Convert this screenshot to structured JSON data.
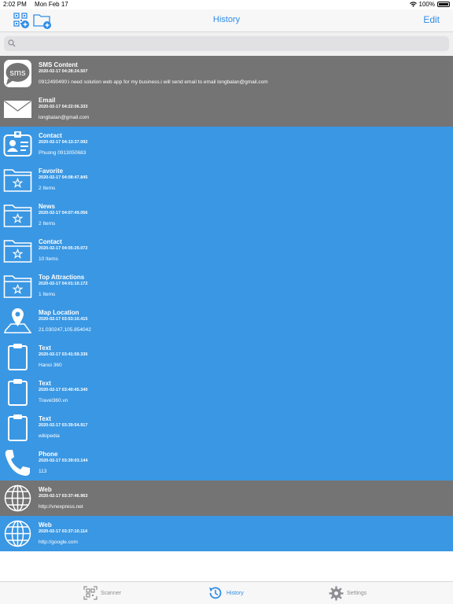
{
  "status_bar": {
    "time": "2:02 PM",
    "date": "Mon Feb 17",
    "battery": "100%"
  },
  "nav": {
    "title": "History",
    "edit_label": "Edit"
  },
  "search": {
    "placeholder": ""
  },
  "items": [
    {
      "kind": "sms",
      "style": "gray",
      "title": "SMS Content",
      "date": "2020-02-17 04:28:24.507",
      "content": "0912490490:i need solution web app for my business.i will send email to email longbalan@gmail.com"
    },
    {
      "kind": "email",
      "style": "gray",
      "title": "Email",
      "date": "2020-02-17 04:22:06.333",
      "content": "longbalan@gmail.com"
    },
    {
      "kind": "contact",
      "style": "blue",
      "title": "Contact",
      "date": "2020-02-17 04:13:37.092",
      "content": " Phuong 0913050683"
    },
    {
      "kind": "folder",
      "style": "blue",
      "title": "Favorite",
      "date": "2020-02-17 04:08:47.845",
      "content": "2 Items"
    },
    {
      "kind": "folder",
      "style": "blue",
      "title": "News",
      "date": "2020-02-17 04:07:49.056",
      "content": "2 Items"
    },
    {
      "kind": "folder",
      "style": "blue",
      "title": "Contact",
      "date": "2020-02-17 04:05:29.072",
      "content": "10 Items"
    },
    {
      "kind": "folder",
      "style": "blue",
      "title": "Top Attractions",
      "date": "2020-02-17 04:01:10.172",
      "content": "1 Items"
    },
    {
      "kind": "map",
      "style": "blue",
      "title": "Map Location",
      "date": "2020-02-17 03:53:10.415",
      "content": "21.030247,105.854042"
    },
    {
      "kind": "text",
      "style": "blue",
      "title": "Text",
      "date": "2020-02-17 03:41:59.336",
      "content": "Hanoi 360"
    },
    {
      "kind": "text",
      "style": "blue",
      "title": "Text",
      "date": "2020-02-17 03:40:45.340",
      "content": "Travel360.vn"
    },
    {
      "kind": "text",
      "style": "blue",
      "title": "Text",
      "date": "2020-02-17 03:39:54.917",
      "content": "wikipedia"
    },
    {
      "kind": "phone",
      "style": "blue",
      "title": "Phone",
      "date": "2020-02-17 03:39:03.144",
      "content": "113"
    },
    {
      "kind": "web",
      "style": "gray",
      "title": "Web",
      "date": "2020-02-17 03:37:46.963",
      "content": "http://vnexpress.net"
    },
    {
      "kind": "web",
      "style": "blue",
      "title": "Web",
      "date": "2020-02-17 03:37:10.114",
      "content": "http://google.com"
    }
  ],
  "tabs": [
    {
      "label": "Scanner",
      "icon": "qr-scanner-icon",
      "active": false
    },
    {
      "label": "History",
      "icon": "history-icon",
      "active": true
    },
    {
      "label": "Settings",
      "icon": "gear-icon",
      "active": false
    }
  ],
  "colors": {
    "accent": "#2f8ce8",
    "row_blue": "#3a97e3",
    "row_gray": "#747474"
  }
}
